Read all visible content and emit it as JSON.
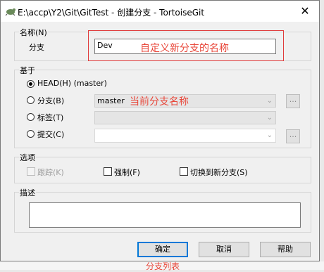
{
  "window": {
    "title": "E:\\accp\\Y2\\Git\\GitTest - 创建分支 - TortoiseGit",
    "close_glyph": "✕"
  },
  "name_group": {
    "label": "名称(N)",
    "branch_label": "分支",
    "branch_value": "Dev"
  },
  "base_group": {
    "label": "基于",
    "head_label": "HEAD(H) (master)",
    "branch_label": "分支(B)",
    "branch_value": "master",
    "tag_label": "标签(T)",
    "commit_label": "提交(C)",
    "dots": "..."
  },
  "options_group": {
    "label": "选项",
    "track_label": "跟踪(K)",
    "force_label": "强制(F)",
    "switch_label": "切换到新分支(S)"
  },
  "desc_group": {
    "label": "描述"
  },
  "buttons": {
    "ok": "确定",
    "cancel": "取消",
    "help": "帮助"
  },
  "annotations": {
    "name_note": "自定义新分支的名称",
    "branch_note": "当前分支名称",
    "bottom_note": "分支列表"
  },
  "colors": {
    "annotation": "#e8473a",
    "default_button_border": "#0078d7"
  }
}
